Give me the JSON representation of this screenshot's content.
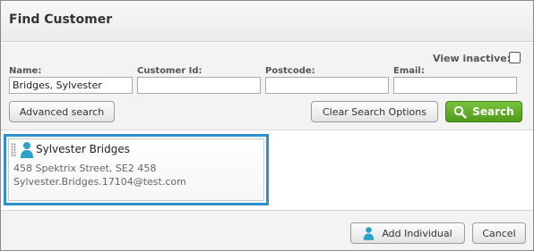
{
  "dialog": {
    "title": "Find Customer"
  },
  "search": {
    "view_inactive_label": "View inactive:",
    "view_inactive_checked": false,
    "name_label": "Name:",
    "name_value": "Bridges, Sylvester",
    "customer_id_label": "Customer Id:",
    "customer_id_value": "",
    "postcode_label": "Postcode:",
    "postcode_value": "",
    "email_label": "Email:",
    "email_value": "",
    "advanced_search_label": "Advanced search",
    "clear_search_label": "Clear Search Options",
    "search_button_label": "Search"
  },
  "results": [
    {
      "name": "Sylvester Bridges",
      "address": "458 Spektrix Street, SE2 458",
      "email": "Sylvester.Bridges.17104@test.com",
      "icon": "person-icon"
    }
  ],
  "footer": {
    "add_individual_label": "Add Individual",
    "cancel_label": "Cancel"
  },
  "colors": {
    "accent": "#2f8fd0",
    "search_green": "#5ba824",
    "person_icon": "#2aa1c6"
  }
}
